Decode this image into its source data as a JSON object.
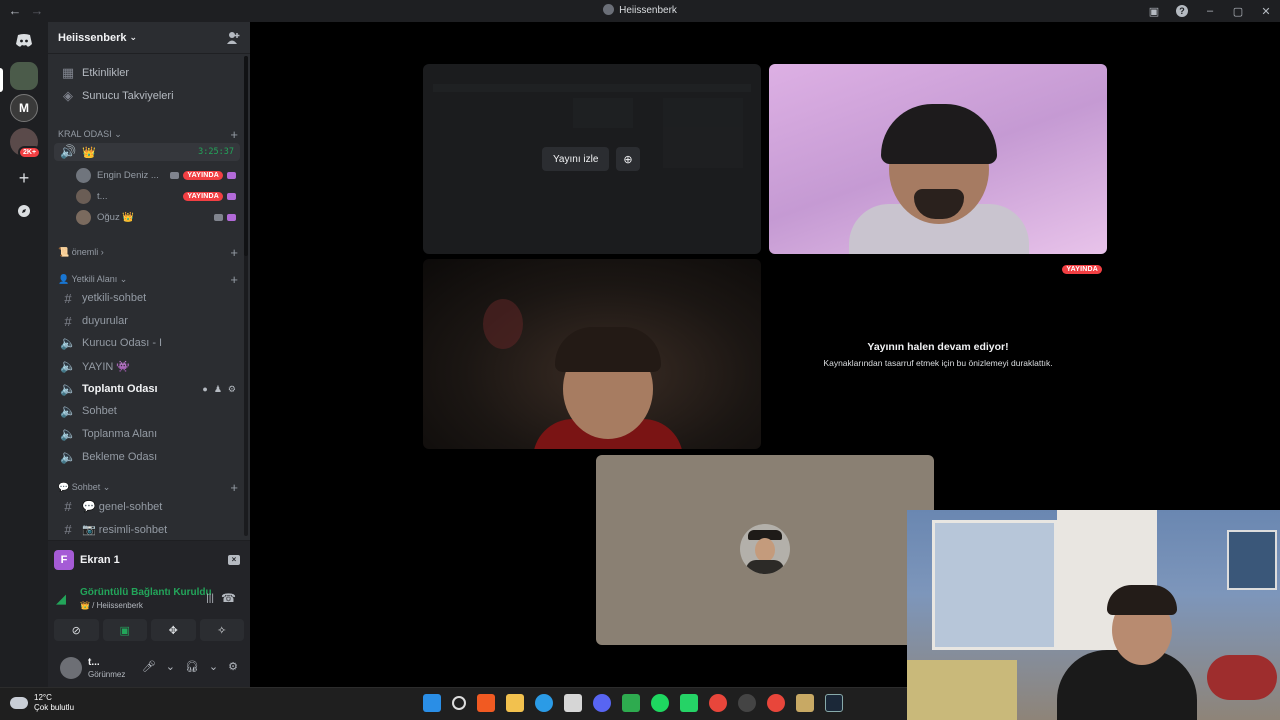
{
  "window": {
    "title": "Heiissenberk",
    "back_icon": "arrow-left-icon",
    "forward_icon": "arrow-right-icon"
  },
  "server": {
    "name": "Heiissenberk",
    "quick_links": [
      {
        "label": "Etkinlikler",
        "icon": "calendar-icon"
      },
      {
        "label": "Sunucu Takviyeleri",
        "icon": "boost-icon"
      }
    ]
  },
  "categories": {
    "kral": "KRAL ODASI",
    "onemli": "📜 önemli",
    "yetkili": "👤 Yetkili Alanı",
    "sohbet": "💬 Sohbet"
  },
  "kral_voice": {
    "name": "👑",
    "timer": "3:25:37",
    "users": [
      {
        "name": "Engin Deniz ...",
        "badge": "YAYINDA"
      },
      {
        "name": "t...",
        "badge": "YAYINDA"
      },
      {
        "name": "Oğuz 👑",
        "badge": ""
      }
    ]
  },
  "channels": {
    "yetkili_sohbet": "yetkili-sohbet",
    "duyurular": "duyurular",
    "kurucu": "Kurucu Odası - I",
    "yayin": "YAYIN 👾",
    "toplanti": "Toplantı Odası",
    "sohbet": "Sohbet",
    "toplanma": "Toplanma Alanı",
    "bekleme": "Bekleme Odası",
    "genel": "💬 genel-sohbet",
    "resimli": "📷 resimli-sohbet"
  },
  "voice_panel": {
    "stream_icon_letter": "F",
    "stream_label": "Ekran 1",
    "status": "Görüntülü Bağlantı Kuruldu",
    "location": "👑 / Heiissenberk",
    "user_name": "t...",
    "user_status": "Görünmez"
  },
  "rail": {
    "badge_count": "2K+"
  },
  "stage": {
    "watch_button": "Yayını izle",
    "live_badge": "YAYINDA",
    "paused_title": "Yayının halen devam ediyor!",
    "paused_subtitle": "Kaynaklarından tasarruf etmek için bu önizlemeyi duraklattık."
  },
  "taskbar": {
    "temperature": "12°C",
    "condition": "Çok bulutlu"
  },
  "colors": {
    "accent_green": "#23a55a",
    "live_red": "#f23f43",
    "sidebar": "#2b2d31",
    "rail": "#1e1f22"
  }
}
